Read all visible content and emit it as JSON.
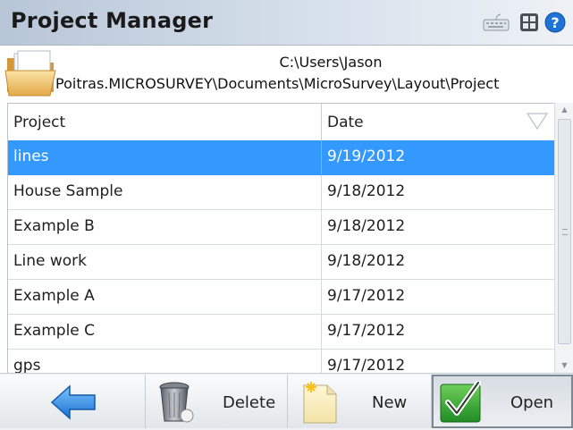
{
  "window": {
    "title": "Project Manager",
    "icons": [
      "keyboard-icon",
      "windows-icon",
      "help-icon"
    ]
  },
  "path": {
    "line1": "C:\\Users\\Jason",
    "line2": "Poitras.MICROSURVEY\\Documents\\MicroSurvey\\Layout\\Project"
  },
  "table": {
    "columns": [
      "Project",
      "Date"
    ],
    "sort_column": "Date",
    "selected_index": 0,
    "rows": [
      {
        "project": "lines",
        "date": "9/19/2012"
      },
      {
        "project": "House Sample",
        "date": "9/18/2012"
      },
      {
        "project": "Example B",
        "date": "9/18/2012"
      },
      {
        "project": "Line work",
        "date": "9/18/2012"
      },
      {
        "project": "Example A",
        "date": "9/17/2012"
      },
      {
        "project": "Example C",
        "date": "9/17/2012"
      },
      {
        "project": "gps",
        "date": "9/17/2012"
      }
    ]
  },
  "toolbar": {
    "back_icon": "back-arrow-icon",
    "delete_label": "Delete",
    "new_label": "New",
    "open_label": "Open"
  },
  "colors": {
    "selection": "#3399ff",
    "title_bar": "#b7c6d7"
  }
}
